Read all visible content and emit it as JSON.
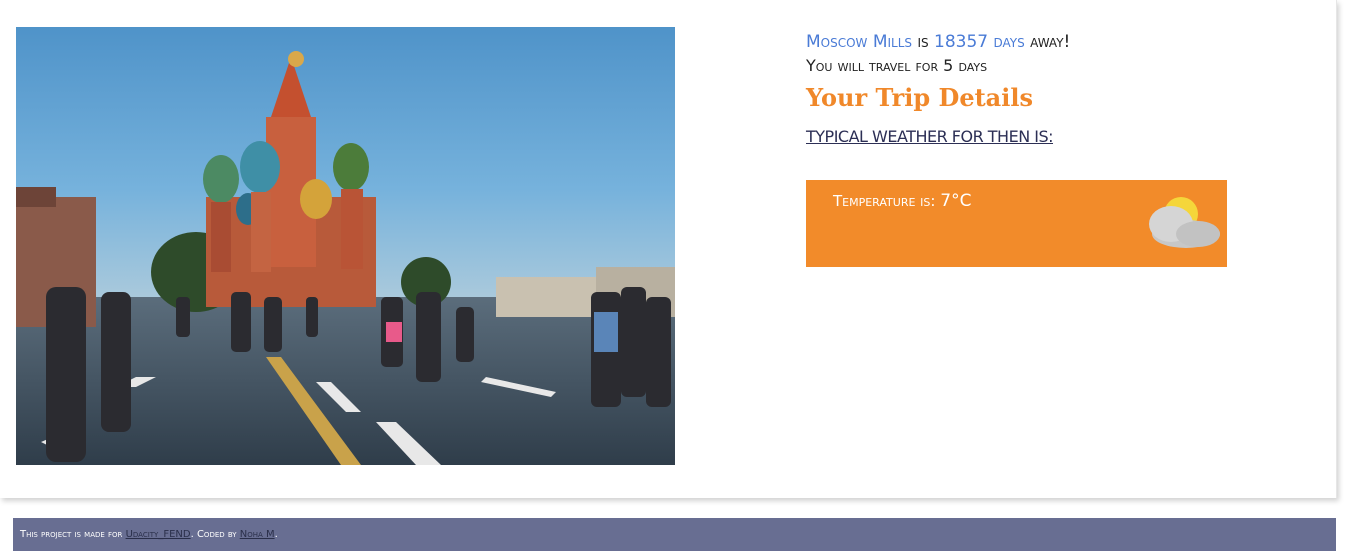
{
  "trip": {
    "destination": "Moscow Mills",
    "is_text": "is",
    "days_away_count": "18357",
    "days_word": "days",
    "away_text": "away!",
    "travel_text": "You will travel for 5 days"
  },
  "details": {
    "title": "Your Trip Details",
    "weather_heading": "TYPICAL WEATHER FOR THEN IS:",
    "temperature_label": "Temperature is:",
    "temperature_value": "7°C",
    "weather_icon": "partly-cloudy-icon",
    "box_color": "#f28b2a"
  },
  "footer": {
    "prefix": "This project is made for",
    "link1": "Udacity_FEND",
    "middle": ". Coded by",
    "link2": "Noha M",
    "suffix": "."
  },
  "colors": {
    "accent_orange": "#f0882a",
    "link_blue": "#4a7bd6",
    "footer_bg": "#686e92"
  }
}
